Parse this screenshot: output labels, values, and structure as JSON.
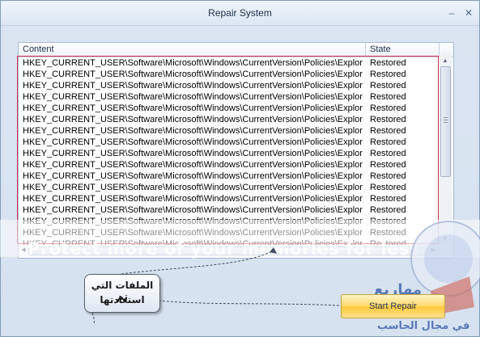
{
  "window": {
    "title": "Repair System",
    "minimize_icon": "minimize-icon",
    "close_icon": "close-icon"
  },
  "list": {
    "columns": [
      "Content",
      "State"
    ],
    "rows": [
      {
        "content": "HKEY_CURRENT_USER\\Software\\Microsoft\\Windows\\CurrentVersion\\Policies\\Explorer",
        "state": "Restored"
      },
      {
        "content": "HKEY_CURRENT_USER\\Software\\Microsoft\\Windows\\CurrentVersion\\Policies\\Explorer",
        "state": "Restored"
      },
      {
        "content": "HKEY_CURRENT_USER\\Software\\Microsoft\\Windows\\CurrentVersion\\Policies\\Explorer",
        "state": "Restored"
      },
      {
        "content": "HKEY_CURRENT_USER\\Software\\Microsoft\\Windows\\CurrentVersion\\Policies\\Explorer",
        "state": "Restored"
      },
      {
        "content": "HKEY_CURRENT_USER\\Software\\Microsoft\\Windows\\CurrentVersion\\Policies\\Explorer",
        "state": "Restored"
      },
      {
        "content": "HKEY_CURRENT_USER\\Software\\Microsoft\\Windows\\CurrentVersion\\Policies\\Explorer",
        "state": "Restored"
      },
      {
        "content": "HKEY_CURRENT_USER\\Software\\Microsoft\\Windows\\CurrentVersion\\Policies\\Explorer",
        "state": "Restored"
      },
      {
        "content": "HKEY_CURRENT_USER\\Software\\Microsoft\\Windows\\CurrentVersion\\Policies\\Explorer",
        "state": "Restored"
      },
      {
        "content": "HKEY_CURRENT_USER\\Software\\Microsoft\\Windows\\CurrentVersion\\Policies\\Explorer",
        "state": "Restored"
      },
      {
        "content": "HKEY_CURRENT_USER\\Software\\Microsoft\\Windows\\CurrentVersion\\Policies\\Explorer",
        "state": "Restored"
      },
      {
        "content": "HKEY_CURRENT_USER\\Software\\Microsoft\\Windows\\CurrentVersion\\Policies\\Explorer",
        "state": "Restored"
      },
      {
        "content": "HKEY_CURRENT_USER\\Software\\Microsoft\\Windows\\CurrentVersion\\Policies\\Explorer",
        "state": "Restored"
      },
      {
        "content": "HKEY_CURRENT_USER\\Software\\Microsoft\\Windows\\CurrentVersion\\Policies\\Explorer",
        "state": "Restored"
      },
      {
        "content": "HKEY_CURRENT_USER\\Software\\Microsoft\\Windows\\CurrentVersion\\Policies\\Explorer",
        "state": "Restored"
      },
      {
        "content": "HKEY_CURRENT_USER\\Software\\Microsoft\\Windows\\CurrentVersion\\Policies\\Explorer",
        "state": "Restored"
      },
      {
        "content": "HKEY_CURRENT_USER\\Software\\Microsoft\\Windows\\CurrentVersion\\Policies\\Explorer",
        "state": "Restored"
      },
      {
        "content": "HKEY_CURRENT_USER\\Software\\Microsoft\\Windows\\CurrentVersion\\Policies\\Explorer",
        "state": "Restored"
      }
    ]
  },
  "watermark": "Protect more of your memories for less",
  "start_button": "Start Repair",
  "callout": {
    "line1": "الملفات التي تم",
    "line2": "استعادتها"
  },
  "logo": {
    "line1": "مهاريع",
    "line2": "في مجال الحاسب"
  },
  "colors": {
    "highlight_border": "#d4314a",
    "button_gold": "#ffd86b",
    "list_border": "#a5b9d3"
  }
}
